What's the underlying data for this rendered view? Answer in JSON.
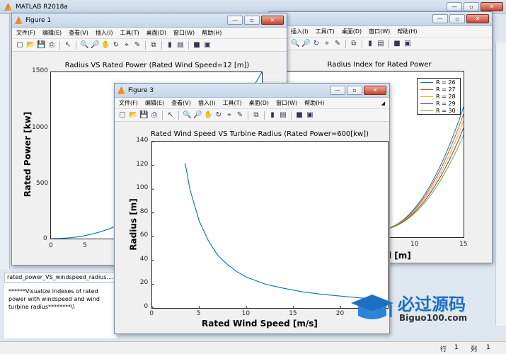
{
  "app": {
    "title": "MATLAB R2018a"
  },
  "menu": [
    "文件(F)",
    "编辑(E)",
    "查看(V)",
    "插入(I)",
    "工具(T)",
    "桌面(D)",
    "窗口(W)",
    "帮助(H)"
  ],
  "window_buttons": {
    "minimize": "—",
    "maximize": "▫",
    "close": "✕"
  },
  "figure1": {
    "title": "Figure 1",
    "chart_data": {
      "type": "line",
      "title": "Radius VS Rated Power (Rated Wind Speed=12 [m])",
      "ylabel": "Rated Power [kw]",
      "xlabel": "",
      "xlim": [
        0,
        15
      ],
      "ylim": [
        0,
        1500
      ],
      "xticks": [
        "0",
        "5"
      ],
      "yticks": [
        "0",
        "500",
        "1000",
        "1500"
      ]
    }
  },
  "figure2": {
    "chart_data": {
      "type": "line",
      "title": "Radius Index for Rated Power",
      "xlabel_visible_fragment": "l [m]",
      "xlim": [
        0,
        15
      ],
      "xticks": [
        "10",
        "15"
      ],
      "legend_position": "top-right",
      "series": [
        {
          "name": "R = 26",
          "color": "#0072BD"
        },
        {
          "name": "R = 27",
          "color": "#D95319"
        },
        {
          "name": "R = 28",
          "color": "#EDB120"
        },
        {
          "name": "R = 29",
          "color": "#7E2F8E"
        },
        {
          "name": "R = 30",
          "color": "#77AC30"
        }
      ]
    }
  },
  "figure3": {
    "title": "Figure 3",
    "chart_data": {
      "type": "line",
      "title": "Rated Wind Speed VS Turbine Radius (Rated Power=600[kw])",
      "xlabel": "Rated Wind Speed [m/s]",
      "ylabel": "Radius [m]",
      "xlim": [
        0,
        25
      ],
      "ylim": [
        0,
        140
      ],
      "xticks": [
        "0",
        "5",
        "10",
        "15",
        "20"
      ],
      "yticks": [
        "0",
        "20",
        "40",
        "60",
        "80",
        "100",
        "120",
        "140"
      ],
      "x": [
        3.5,
        4,
        5,
        6,
        7,
        8,
        9,
        10,
        12,
        14,
        16,
        18,
        20,
        22,
        24
      ],
      "y": [
        122,
        100,
        73,
        56,
        44,
        36.5,
        30.5,
        26,
        20,
        16.5,
        13.5,
        11.5,
        10,
        8.5,
        7.5
      ],
      "color": "#0072BD"
    }
  },
  "background_panel": {
    "file_tab": "rated_power_VS_windspeed_radius....",
    "comment": "******Visualize indexes of rated power with windspeed and wind turbine radius********\\\\"
  },
  "status_bar": {
    "row_label": "行",
    "row_value": "1",
    "col_label": "列",
    "col_value": "1"
  },
  "watermark": {
    "text_cn": "必过源码",
    "text_en": "Biguo100.com"
  }
}
